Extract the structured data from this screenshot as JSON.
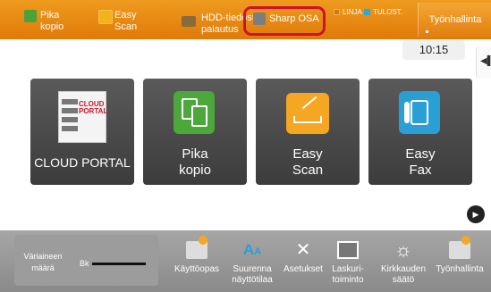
{
  "topbar": {
    "quick_buttons": [
      {
        "label": "Pika\nkopio",
        "icon": "copy-icon"
      },
      {
        "label": "Easy\nScan",
        "icon": "scan-icon"
      },
      {
        "label": "HDD-tiedosto\npalautus",
        "icon": "folder-icon"
      },
      {
        "label": "Sharp OSA",
        "icon": "osa-icon"
      }
    ],
    "status": [
      {
        "label": "LINJA"
      },
      {
        "label": "TULOST."
      }
    ],
    "job_status_label": "Työnhallinta",
    "highlight_color": "#d0102c"
  },
  "main": {
    "time": "10:15",
    "tiles": [
      {
        "label": "CLOUD PORTAL",
        "logo_text": "CLOUD\nPORTAL",
        "icon": "cloud-portal-icon"
      },
      {
        "label": "Pika\nkopio",
        "icon": "copy-icon"
      },
      {
        "label": "Easy\nScan",
        "icon": "scan-icon"
      },
      {
        "label": "Easy\nFax",
        "icon": "fax-icon"
      }
    ],
    "pages": {
      "total": 4,
      "current": 1
    }
  },
  "bottombar": {
    "toner_label": "Väriaineen\nmäärä",
    "toner_color": "Bk",
    "buttons": [
      {
        "label": "Käyttöopas",
        "icon": "manual-icon"
      },
      {
        "label": "Suurenna\nnäyttötilaa",
        "icon": "enlarge-display-icon"
      },
      {
        "label": "Asetukset",
        "icon": "settings-tools-icon"
      },
      {
        "label": "Laskuri-\ntoiminto",
        "icon": "counter-icon"
      },
      {
        "label": "Kirkkauden\nsäätö",
        "icon": "brightness-icon"
      },
      {
        "label": "Työnhallinta",
        "icon": "job-status-icon"
      }
    ]
  }
}
